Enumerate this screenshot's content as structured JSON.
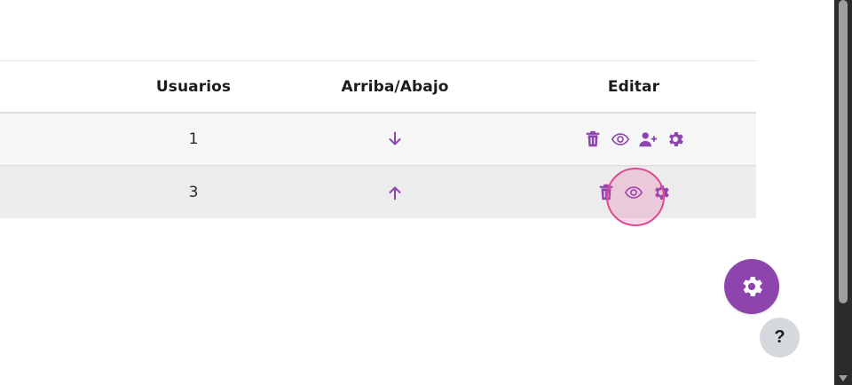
{
  "table": {
    "headers": {
      "users": "Usuarios",
      "updown": "Arriba/Abajo",
      "edit": "Editar"
    },
    "rows": [
      {
        "users": "1",
        "direction": "down",
        "actions": [
          "trash-icon",
          "eye-icon",
          "user-plus-icon",
          "gear-icon"
        ]
      },
      {
        "users": "3",
        "direction": "up",
        "actions": [
          "trash-icon",
          "eye-icon",
          "gear-icon"
        ]
      }
    ]
  },
  "help_button": {
    "label": "?"
  },
  "colors": {
    "accent": "#8e44ad",
    "click_marker": "#de4b94",
    "help_bg": "#d5d8dd"
  }
}
